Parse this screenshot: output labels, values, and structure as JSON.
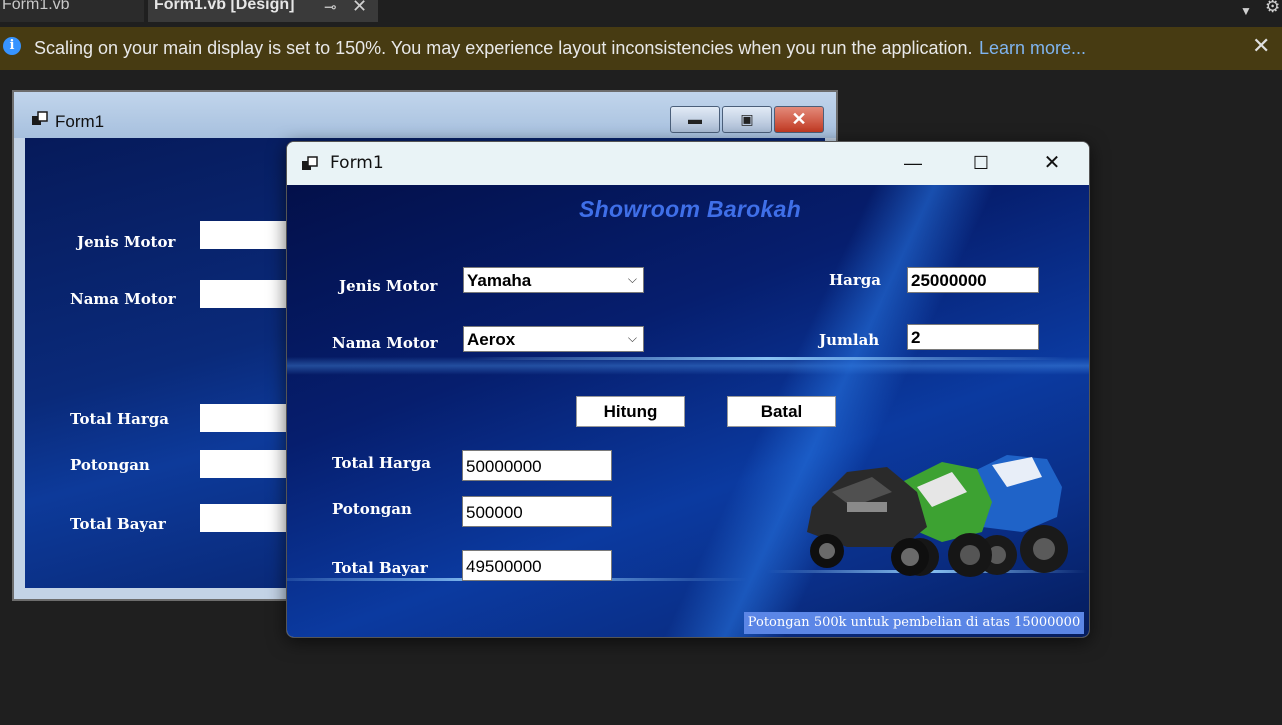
{
  "ide": {
    "tabs": [
      {
        "label": "Form1.vb"
      },
      {
        "label": "Form1.vb [Design]"
      }
    ]
  },
  "infobar": {
    "message": "Scaling on your main display is set to 150%. You may experience layout inconsistencies when you run the application.",
    "link": "Learn more..."
  },
  "designer": {
    "title": "Form1",
    "labels": {
      "jenis_motor": "Jenis Motor",
      "nama_motor": "Nama Motor",
      "total_harga": "Total Harga",
      "potongan": "Potongan",
      "total_bayar": "Total Bayar"
    }
  },
  "app": {
    "title": "Form1",
    "heading": "Showroom Barokah",
    "fields": {
      "jenis_motor": {
        "label": "Jenis Motor",
        "value": "Yamaha"
      },
      "nama_motor": {
        "label": "Nama Motor",
        "value": "Aerox"
      },
      "harga": {
        "label": "Harga",
        "value": "25000000"
      },
      "jumlah": {
        "label": "Jumlah",
        "value": "2"
      },
      "total_harga": {
        "label": "Total Harga",
        "value": "50000000"
      },
      "potongan": {
        "label": "Potongan",
        "value": "500000"
      },
      "total_bayar": {
        "label": "Total Bayar",
        "value": "49500000"
      }
    },
    "buttons": {
      "hitung": "Hitung",
      "batal": "Batal"
    },
    "promo": "Potongan 500k untuk pembelian di atas 15000000"
  }
}
